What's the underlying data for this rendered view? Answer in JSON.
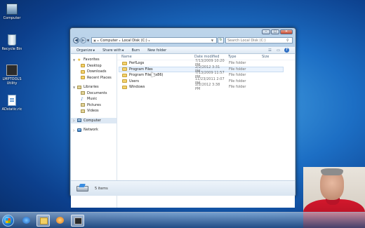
{
  "desktop": {
    "icons": [
      {
        "label": "Computer",
        "icon": "computer-icon"
      },
      {
        "label": "Recycle Bin",
        "icon": "recycle-bin-icon"
      },
      {
        "label": "LMPTOOLS Utility",
        "icon": "app-icon"
      },
      {
        "label": "ADstatic.ric",
        "icon": "document-icon"
      }
    ]
  },
  "window": {
    "breadcrumb": [
      "Computer",
      "Local Disk (C:)"
    ],
    "search_placeholder": "Search Local Disk (C:)",
    "toolbar": {
      "organize": "Organize",
      "share": "Share with",
      "burn": "Burn",
      "new_folder": "New folder"
    },
    "nav": {
      "favorites": {
        "label": "Favorites",
        "items": [
          "Desktop",
          "Downloads",
          "Recent Places"
        ]
      },
      "libraries": {
        "label": "Libraries",
        "items": [
          "Documents",
          "Music",
          "Pictures",
          "Videos"
        ]
      },
      "computer": "Computer",
      "network": "Network"
    },
    "columns": {
      "name": "Name",
      "date": "Date modified",
      "type": "Type",
      "size": "Size"
    },
    "files": [
      {
        "name": "PerfLogs",
        "date": "7/13/2009 10:20 PM",
        "type": "File folder"
      },
      {
        "name": "Program Files",
        "date": "2/2/2012 3:31 PM",
        "type": "File folder"
      },
      {
        "name": "Program Files (x86)",
        "date": "7/13/2009 11:57 PM",
        "type": "File folder"
      },
      {
        "name": "Users",
        "date": "11/23/2011 2:07 PM",
        "type": "File folder"
      },
      {
        "name": "Windows",
        "date": "2/2/2012 3:38 PM",
        "type": "File folder"
      }
    ],
    "status": "5 items"
  },
  "taskbar": {
    "apps": [
      "internet-explorer-icon",
      "windows-explorer-icon",
      "media-player-icon",
      "screen-capture-icon"
    ]
  }
}
